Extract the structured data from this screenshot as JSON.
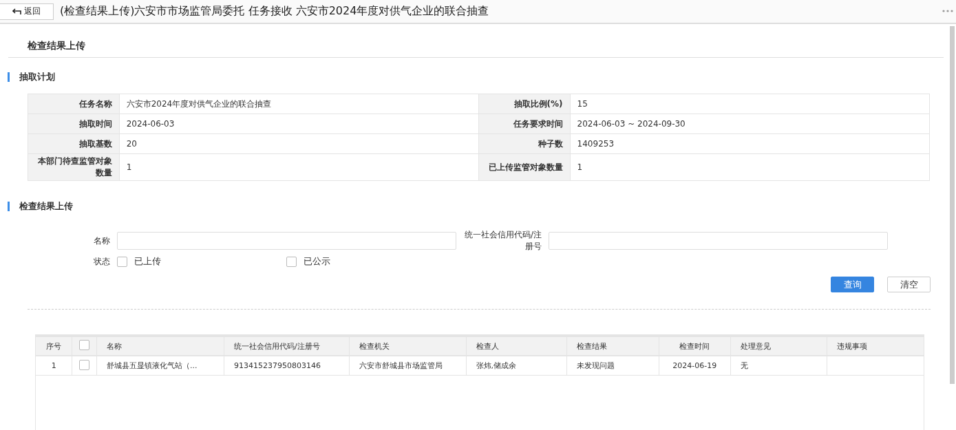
{
  "back_button": "返回",
  "title": "(检查结果上传)六安市市场监管局委托 任务接收 六安市2024年度对供气企业的联合抽查",
  "page_heading": "检查结果上传",
  "plan": {
    "heading": "抽取计划",
    "rows": [
      [
        {
          "label": "任务名称",
          "value": "六安市2024年度对供气企业的联合抽查"
        },
        {
          "label": "抽取比例(%)",
          "value": "15"
        }
      ],
      [
        {
          "label": "抽取时间",
          "value": "2024-06-03"
        },
        {
          "label": "任务要求时间",
          "value": "2024-06-03 ~ 2024-09-30"
        }
      ],
      [
        {
          "label": "抽取基数",
          "value": "20"
        },
        {
          "label": "种子数",
          "value": "1409253"
        }
      ],
      [
        {
          "label": "本部门待查监管对象数量",
          "value": "1"
        },
        {
          "label": "已上传监管对象数量",
          "value": "1"
        }
      ]
    ]
  },
  "search": {
    "heading": "检查结果上传",
    "fields": [
      {
        "label": "名称"
      },
      {
        "label": "统一社会信用代码/注册号"
      }
    ],
    "status_label": "状态",
    "status_options": [
      {
        "label": "已上传",
        "checked": false
      },
      {
        "label": "已公示",
        "checked": false
      }
    ],
    "buttons": [
      {
        "label": "查询",
        "kind": "primary"
      },
      {
        "label": "清空",
        "kind": "default"
      }
    ]
  },
  "table": {
    "header_checked": false,
    "columns": [
      "序号",
      "名称",
      "统一社会信用代码/注册号",
      "检查机关",
      "检查人",
      "检查结果",
      "检查时间",
      "处理意见",
      "违规事项"
    ],
    "rows": [
      {
        "checked": false,
        "cells": [
          "1",
          "舒城县五显镇液化气站（...",
          "913415237950803146",
          "六安市舒城县市场监管局",
          "张炜,储成余",
          "未发现问题",
          "2024-06-19",
          "无",
          ""
        ]
      }
    ]
  }
}
